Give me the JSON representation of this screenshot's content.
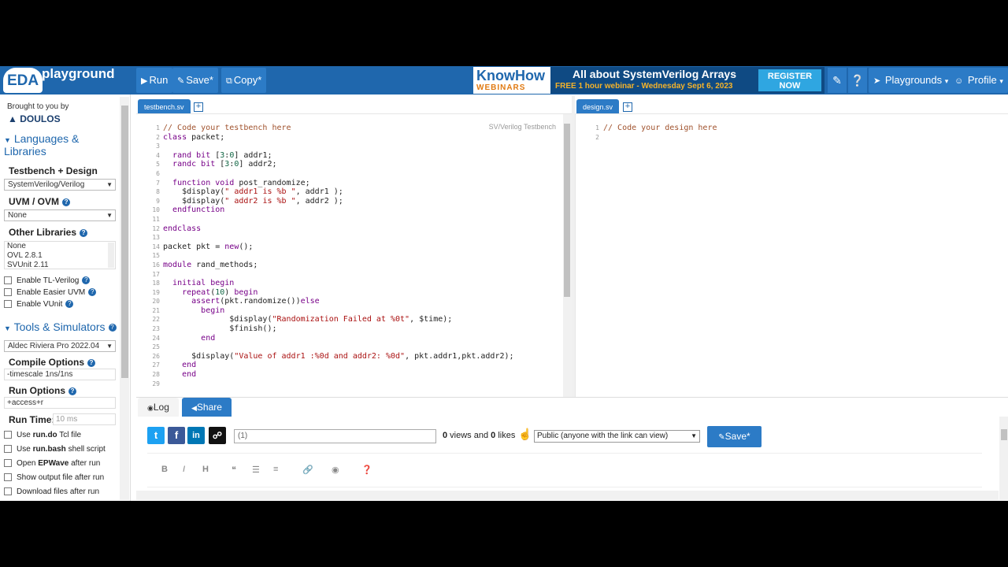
{
  "brand": {
    "logo": "EDA",
    "name": "playground"
  },
  "toolbar": {
    "run_label": "Run",
    "save_label": "Save*",
    "copy_label": "Copy*",
    "playgrounds_label": "Playgrounds",
    "profile_label": "Profile"
  },
  "banner": {
    "logo_top": "KnowHow",
    "logo_bottom": "WEBINARS",
    "headline": "All about SystemVerilog Arrays",
    "subline": "FREE 1 hour webinar - Wednesday Sept 6, 2023",
    "cta_line1": "REGISTER",
    "cta_line2": "NOW"
  },
  "sidebar": {
    "brought_by": "Brought to you by",
    "sponsor": "DOULOS",
    "languages_title_1": "Languages &",
    "languages_title_2": "Libraries",
    "testbench_design_label": "Testbench + Design",
    "testbench_design_value": "SystemVerilog/Verilog",
    "uvm_label": "UVM / OVM",
    "uvm_value": "None",
    "other_libs_label": "Other Libraries",
    "other_libs": [
      "None",
      "OVL 2.8.1",
      "SVUnit 2.11"
    ],
    "enable_tl": "Enable TL-Verilog",
    "enable_easier_uvm": "Enable Easier UVM",
    "enable_vunit": "Enable VUnit",
    "tools_title": "Tools & Simulators",
    "simulator_value": "Aldec Riviera Pro 2022.04",
    "compile_label": "Compile Options",
    "compile_value": "-timescale 1ns/1ns",
    "run_label": "Run Options",
    "run_value": "+access+r",
    "runtime_label": "Run Time:",
    "runtime_placeholder": "10 ms",
    "use_rundo_pre": "Use ",
    "use_rundo_bold": "run.do",
    "use_rundo_post": " Tcl file",
    "use_runbash_pre": "Use ",
    "use_runbash_bold": "run.bash",
    "use_runbash_post": " shell script",
    "open_epwave_pre": "Open ",
    "open_epwave_bold": "EPWave",
    "open_epwave_post": " after run",
    "show_output": "Show output file after run",
    "download_files": "Download files after run"
  },
  "testbench": {
    "tab": "testbench.sv",
    "label": "SV/Verilog Testbench"
  },
  "design": {
    "tab": "design.sv",
    "lines": [
      "// Code your design here",
      ""
    ]
  },
  "bottom": {
    "log_tab": "Log",
    "share_tab": "Share",
    "title_value": "(1)",
    "views_count": "0",
    "views_text": " views and ",
    "likes_count": "0",
    "likes_text": " likes",
    "visibility": "Public (anyone with the link can view)",
    "save_label": "Save*"
  },
  "colors": {
    "primary": "#1f67ad",
    "button": "#2c7bc6",
    "twitter": "#1da1f2",
    "facebook": "#3b5998",
    "linkedin": "#0077b5"
  }
}
